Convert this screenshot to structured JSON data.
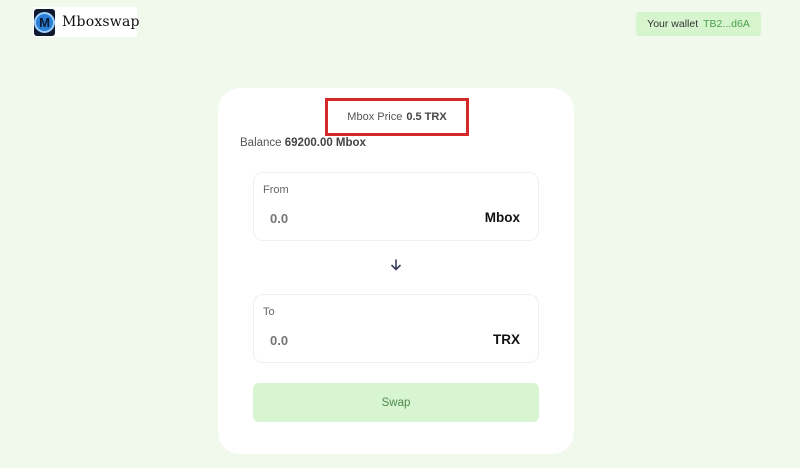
{
  "header": {
    "brand_name": "Mboxswap",
    "logo_letter": "M",
    "wallet_label": "Your wallet",
    "wallet_address": "TB2...d6A"
  },
  "card": {
    "price_label": "Mbox Price",
    "price_value": "0.5 TRX",
    "balance_label": "Balance",
    "balance_value": "69200.00 Mbox",
    "from": {
      "label": "From",
      "placeholder": "0.0",
      "token": "Mbox"
    },
    "to": {
      "label": "To",
      "placeholder": "0.0",
      "token": "TRX"
    },
    "swap_label": "Swap"
  },
  "colors": {
    "background": "#f1f9ec",
    "accent_green": "#d8f5d1",
    "highlight_border": "#d62828"
  },
  "icons": {
    "logo": "mboxswap-logo-icon",
    "direction": "arrow-down-icon"
  }
}
